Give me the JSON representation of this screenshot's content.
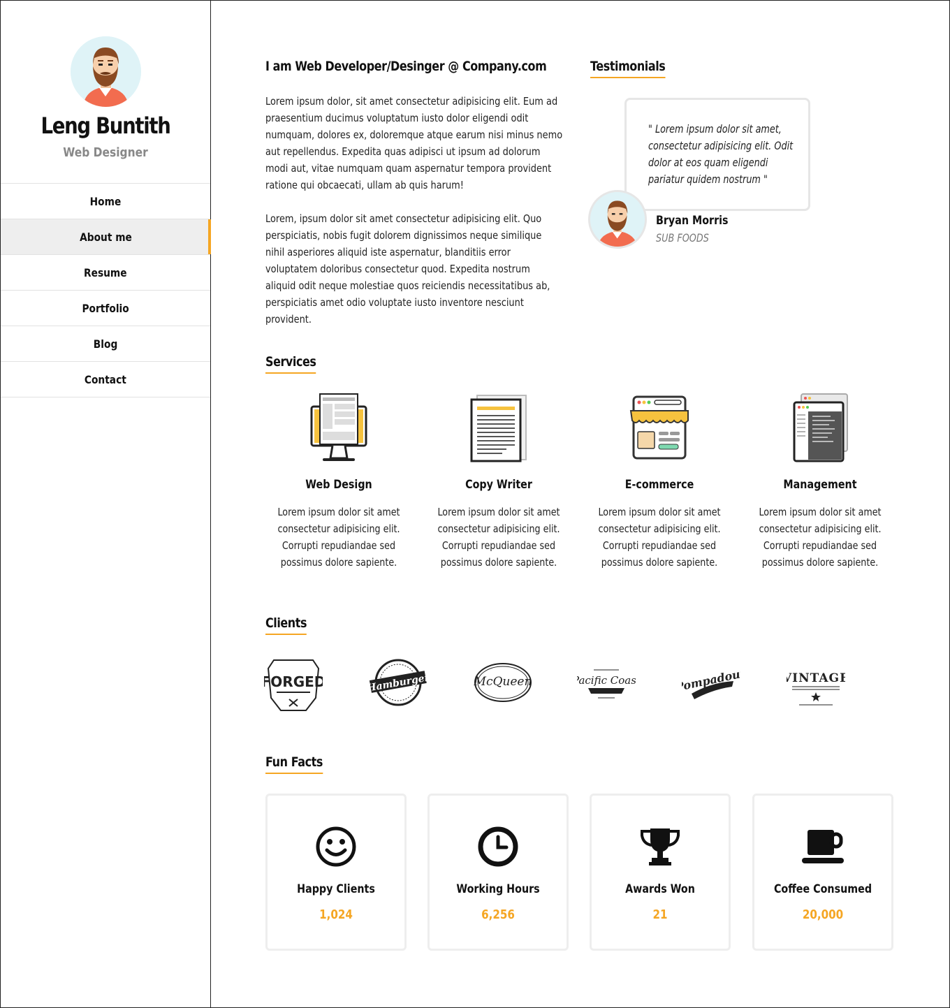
{
  "profile": {
    "name": "Leng Buntith",
    "role": "Web Designer"
  },
  "nav": {
    "items": [
      {
        "label": "Home"
      },
      {
        "label": "About me",
        "active": true
      },
      {
        "label": "Resume"
      },
      {
        "label": "Portfolio"
      },
      {
        "label": "Blog"
      },
      {
        "label": "Contact"
      }
    ]
  },
  "about": {
    "heading": "I am Web Developer/Desinger @ Company.com",
    "paragraph_1": "Lorem ipsum dolor, sit amet consectetur adipisicing elit. Eum ad praesentium ducimus voluptatum iusto dolor eligendi odit numquam, dolores ex, doloremque atque earum nisi minus nemo aut repellendus. Expedita quas adipisci ut ipsum ad dolorum modi aut, vitae numquam quam aspernatur tempora provident ratione qui obcaecati, ullam ab quis harum!",
    "paragraph_2": "Lorem, ipsum dolor sit amet consectetur adipisicing elit. Quo perspiciatis, nobis fugit dolorem dignissimos neque similique nihil asperiores aliquid iste aspernatur, blanditiis error voluptatem doloribus consectetur quod. Expedita nostrum aliquid odit neque molestiae quos reiciendis necessitatibus ab, perspiciatis amet odio voluptate iusto inventore nesciunt provident."
  },
  "testimonials": {
    "heading": "Testimonials",
    "quote": "\" Lorem ipsum dolor sit amet, consectetur adipisicing elit. Odit dolor at eos quam eligendi pariatur quidem nostrum \"",
    "name": "Bryan Morris",
    "company": "SUB FOODS"
  },
  "services": {
    "heading": "Services",
    "items": [
      {
        "title": "Web Design",
        "icon": "monitor-icon",
        "description": "Lorem ipsum dolor sit amet consectetur adipisicing elit. Corrupti repudiandae sed possimus dolore sapiente."
      },
      {
        "title": "Copy Writer",
        "icon": "document-icon",
        "description": "Lorem ipsum dolor sit amet consectetur adipisicing elit. Corrupti repudiandae sed possimus dolore sapiente."
      },
      {
        "title": "E-commerce",
        "icon": "storefront-icon",
        "description": "Lorem ipsum dolor sit amet consectetur adipisicing elit. Corrupti repudiandae sed possimus dolore sapiente."
      },
      {
        "title": "Management",
        "icon": "browser-windows-icon",
        "description": "Lorem ipsum dolor sit amet consectetur adipisicing elit. Corrupti repudiandae sed possimus dolore sapiente."
      }
    ]
  },
  "clients": {
    "heading": "Clients",
    "logos": [
      {
        "name": "FORGED"
      },
      {
        "name": "Hamburger"
      },
      {
        "name": "McQueen"
      },
      {
        "name": "Pacific Coast"
      },
      {
        "name": "Pompadour"
      },
      {
        "name": "VINTAGE"
      }
    ]
  },
  "fun_facts": {
    "heading": "Fun Facts",
    "items": [
      {
        "label": "Happy Clients",
        "value": "1,024",
        "icon": "smiley-icon"
      },
      {
        "label": "Working Hours",
        "value": "6,256",
        "icon": "clock-icon"
      },
      {
        "label": "Awards Won",
        "value": "21",
        "icon": "trophy-icon"
      },
      {
        "label": "Coffee Consumed",
        "value": "20,000",
        "icon": "coffee-cup-icon"
      }
    ]
  },
  "colors": {
    "accent": "#f5a623",
    "muted_text": "#888888",
    "active_nav_bg": "#eeeeee"
  }
}
